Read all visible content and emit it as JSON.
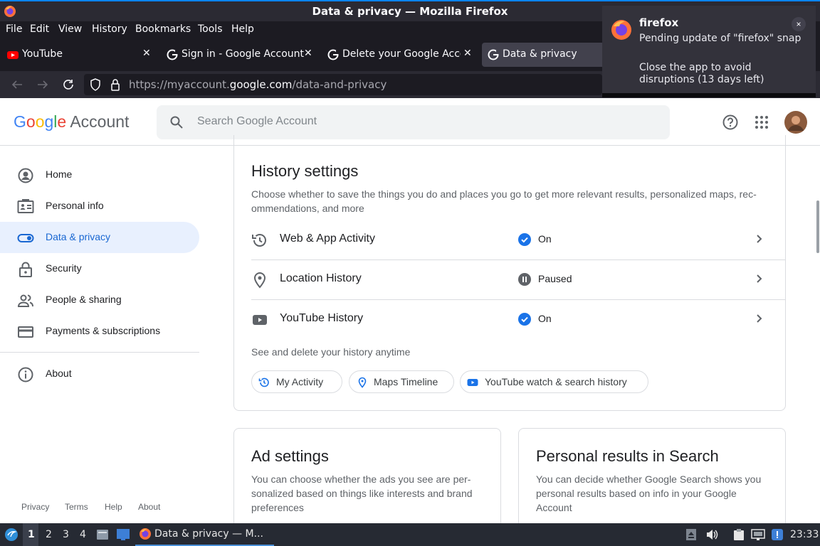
{
  "window": {
    "title": "Data & privacy — Mozilla Firefox"
  },
  "menu": [
    "File",
    "Edit",
    "View",
    "History",
    "Bookmarks",
    "Tools",
    "Help"
  ],
  "tabs": [
    {
      "label": "YouTube",
      "icon": "youtube-icon"
    },
    {
      "label": "Sign in - Google Accounts",
      "icon": "google-g-icon"
    },
    {
      "label": "Delete your Google Acco",
      "icon": "google-g-icon"
    },
    {
      "label": "Data & privacy",
      "icon": "google-g-icon"
    }
  ],
  "address": {
    "prefix": "https://myaccount.",
    "domain": "google.com",
    "path": "/data-and-privacy"
  },
  "notification": {
    "app": "firefox",
    "line1": "Pending update of \"firefox\" snap",
    "line2": "Close the app to avoid disruptions (13 days left)",
    "close": "×"
  },
  "header": {
    "logo_google": "Google",
    "logo_account": "Account",
    "search_placeholder": "Search Google Account"
  },
  "sidebar": {
    "items": [
      {
        "label": "Home",
        "icon": "home-icon"
      },
      {
        "label": "Personal info",
        "icon": "id-card-icon"
      },
      {
        "label": "Data & privacy",
        "icon": "toggle-icon",
        "selected": true
      },
      {
        "label": "Security",
        "icon": "lock-icon"
      },
      {
        "label": "People & sharing",
        "icon": "people-icon"
      },
      {
        "label": "Payments & subscriptions",
        "icon": "card-icon"
      }
    ],
    "about": "About",
    "footer": [
      "Privacy",
      "Terms",
      "Help",
      "About"
    ]
  },
  "history": {
    "title": "History settings",
    "description": "Choose whether to save the things you do and places you go to get more relevant results, personalized maps, rec-ommendations, and more",
    "rows": [
      {
        "label": "Web & App Activity",
        "status": "On"
      },
      {
        "label": "Location History",
        "status": "Paused"
      },
      {
        "label": "YouTube History",
        "status": "On"
      }
    ],
    "see_delete": "See and delete your history anytime",
    "chips": [
      "My Activity",
      "Maps Timeline",
      "YouTube watch & search history"
    ]
  },
  "ad_settings": {
    "title": "Ad settings",
    "description": "You can choose whether the ads you see are per-sonalized based on things like interests and brand preferences"
  },
  "personal_results": {
    "title": "Personal results in Search",
    "description": "You can decide whether Google Search shows you personal results based on info in your Google Account"
  },
  "taskbar": {
    "workspaces": [
      "1",
      "2",
      "3",
      "4"
    ],
    "task": "Data & privacy — M...",
    "clock": "23:33"
  }
}
